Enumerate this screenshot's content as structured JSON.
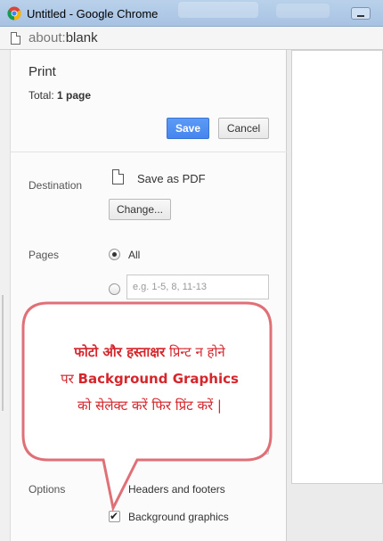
{
  "window": {
    "title": "Untitled - Google Chrome",
    "address_scheme": "about:",
    "address_path": "blank"
  },
  "print": {
    "title": "Print",
    "total_prefix": "Total:",
    "total_value": "1 page",
    "save_label": "Save",
    "cancel_label": "Cancel"
  },
  "destination": {
    "label": "Destination",
    "name": "Save as PDF",
    "change_label": "Change..."
  },
  "pages": {
    "label": "Pages",
    "all_label": "All",
    "range_placeholder": "e.g. 1-5, 8, 11-13",
    "selected": "All"
  },
  "options": {
    "label": "Options",
    "headers_footers_label": "Headers and footers",
    "headers_footers_checked": false,
    "background_graphics_label": "Background graphics",
    "background_graphics_checked": true
  },
  "callout": {
    "line1_bold": "फोटो और हस्ताक्षर",
    "line1_rest": " प्रिन्ट न होने",
    "line2_prefix": "पर ",
    "line2_bold": "Background Graphics",
    "line3": "को सेलेक्ट करें फिर प्रिंट करें |"
  },
  "colors": {
    "accent_blue": "#4585ee",
    "callout_red": "#d6262c"
  }
}
